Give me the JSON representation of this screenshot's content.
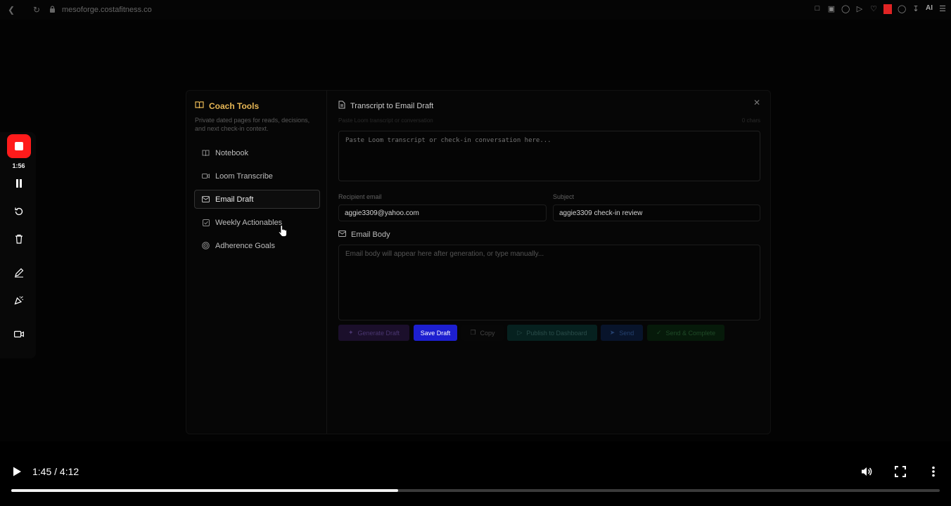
{
  "browser": {
    "url": "mesoforge.costafitness.co",
    "ai_label": "AI"
  },
  "sidebar": {
    "title": "Coach Tools",
    "description": "Private dated pages for reads, decisions, and next check-in context.",
    "items": [
      {
        "label": "Notebook",
        "icon": "book-icon",
        "active": false
      },
      {
        "label": "Loom Transcribe",
        "icon": "video-icon",
        "active": false
      },
      {
        "label": "Email Draft",
        "icon": "mail-icon",
        "active": true
      },
      {
        "label": "Weekly Actionables",
        "icon": "checkbox-icon",
        "active": false
      },
      {
        "label": "Adherence Goals",
        "icon": "target-icon",
        "active": false
      }
    ]
  },
  "panel": {
    "title": "Transcript to Email Draft",
    "transcript_label": "Paste Loom transcript or conversation",
    "char_count": "0 chars",
    "transcript_placeholder": "Paste Loom transcript or check-in conversation here...",
    "recipient_label": "Recipient email",
    "recipient_value": "aggie3309@yahoo.com",
    "subject_label": "Subject",
    "subject_value": "aggie3309 check-in review",
    "body_title": "Email Body",
    "body_placeholder": "Email body will appear here after generation, or type manually...",
    "buttons": {
      "generate": "Generate Draft",
      "save": "Save Draft",
      "copy": "Copy",
      "publish": "Publish to Dashboard",
      "send": "Send",
      "send_complete": "Send & Complete"
    }
  },
  "recorder": {
    "elapsed": "1:56"
  },
  "video": {
    "time": "1:45 / 4:12",
    "progress": 0.4167
  },
  "colors": {
    "accent_gold": "#e7b755",
    "save_blue": "#1d1fd0",
    "record_red": "#ff1b1b"
  }
}
